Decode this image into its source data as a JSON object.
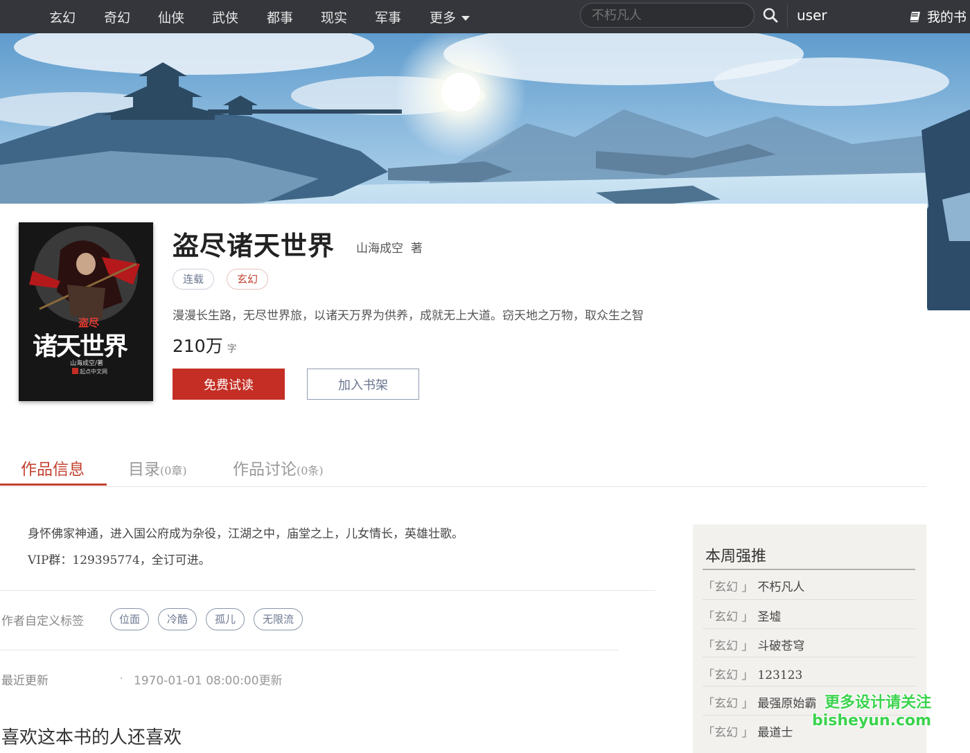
{
  "nav": {
    "items": [
      "玄幻",
      "奇幻",
      "仙侠",
      "武侠",
      "都事",
      "现实",
      "军事"
    ],
    "more_label": "更多",
    "search_placeholder": "不朽凡人",
    "user_label": "user",
    "bookshelf_label": "我的书"
  },
  "book": {
    "title": "盗尽诸天世界",
    "author": "山海成空",
    "author_suffix": "著",
    "status_tag": "连载",
    "genre_tag": "玄幻",
    "intro": "漫漫长生路，无尽世界旅，以诸天万界为供养，成就无上大道。窃天地之万物，取众生之智",
    "word_count": "210万",
    "word_unit": "字",
    "read_button": "免费试读",
    "shelf_button": "加入书架",
    "cover": {
      "small_title": "盗尽",
      "big_title": "诸天世界",
      "author_line": "山海成空/著",
      "publisher": "起点中文网"
    }
  },
  "tabs": [
    {
      "label": "作品信息",
      "suffix": ""
    },
    {
      "label": "目录",
      "suffix": "(0章)"
    },
    {
      "label": "作品讨论",
      "suffix": "(0条)"
    }
  ],
  "details": {
    "description": [
      "身怀佛家神通，进入国公府成为杂役，江湖之中，庙堂之上，儿女情长，英雄壮歌。",
      "VIP群：129395774，全订可进。"
    ],
    "custom_tags_label": "作者自定义标签",
    "custom_tags": [
      "位面",
      "冷酷",
      "孤儿",
      "无限流"
    ],
    "last_update_label": "最近更新",
    "last_update_dot": "·",
    "last_update_time": "1970-01-01 08:00:00",
    "last_update_suffix": "更新",
    "also_like_title": "喜欢这本书的人还喜欢"
  },
  "sidebar": {
    "title": "本周强推",
    "items": [
      {
        "genre": "「玄幻 」",
        "name": "不朽凡人"
      },
      {
        "genre": "「玄幻 」",
        "name": "圣墟"
      },
      {
        "genre": "「玄幻 」",
        "name": "斗破苍穹"
      },
      {
        "genre": "「玄幻 」",
        "name": "123123"
      },
      {
        "genre": "「玄幻 」",
        "name": "最强原始霸"
      },
      {
        "genre": "「玄幻 」",
        "name": "最道士"
      }
    ]
  },
  "watermark": {
    "line1": "更多设计请关注",
    "line2": "bisheyun.com"
  },
  "colors": {
    "nav_bg": "#34363b",
    "accent_red": "#c42e24",
    "tab_active": "#c2402f",
    "sidebar_bg": "#f2f1ee"
  }
}
